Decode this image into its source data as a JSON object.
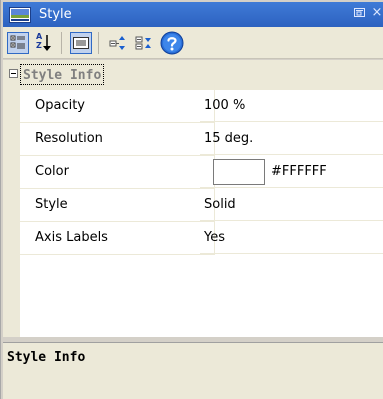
{
  "window": {
    "title": "Style",
    "icons": {
      "app": "monitor-icon",
      "float": "float-window-icon",
      "close": "close-icon"
    },
    "close_glyph": "×"
  },
  "toolbar": {
    "buttons": [
      {
        "name": "categorized-view-icon",
        "pressed": true
      },
      {
        "name": "alphabetical-sort-icon",
        "pressed": false
      },
      {
        "name": "property-pages-icon",
        "pressed": true
      },
      {
        "name": "expand-all-icon",
        "pressed": false
      },
      {
        "name": "collapse-all-icon",
        "pressed": false
      },
      {
        "name": "help-icon",
        "pressed": false
      }
    ],
    "sort_glyph_top": "A",
    "sort_glyph_bottom": "Z"
  },
  "grid": {
    "category": "Style Info",
    "properties": [
      {
        "name": "Opacity",
        "value": "100 %"
      },
      {
        "name": "Resolution",
        "value": "15 deg."
      },
      {
        "name": "Color",
        "value": "#FFFFFF",
        "swatch_color": "#FFFFFF"
      },
      {
        "name": "Style",
        "value": "Solid"
      },
      {
        "name": "Axis Labels",
        "value": "Yes"
      }
    ]
  },
  "description": {
    "title": "Style Info"
  },
  "colors": {
    "titlebar": "#3f7bd7",
    "panel_bg": "#ece9d8",
    "category_text": "#808080",
    "grid_bg": "#ffffff"
  }
}
